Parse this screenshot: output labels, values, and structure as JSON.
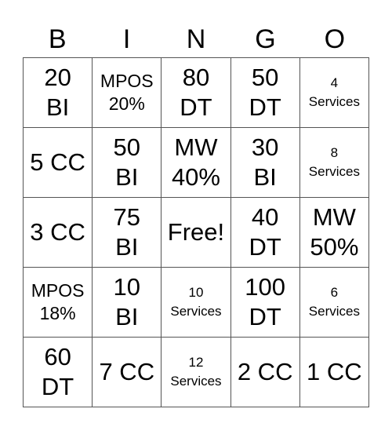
{
  "header": [
    "B",
    "I",
    "N",
    "G",
    "O"
  ],
  "rows": [
    [
      {
        "text": "20\nBI",
        "size": "big"
      },
      {
        "text": "MPOS\n20%",
        "size": "mid"
      },
      {
        "text": "80\nDT",
        "size": "big"
      },
      {
        "text": "50\nDT",
        "size": "big"
      },
      {
        "text": "4\nServices",
        "size": "small"
      }
    ],
    [
      {
        "text": "5 CC",
        "size": "big"
      },
      {
        "text": "50\nBI",
        "size": "big"
      },
      {
        "text": "MW\n40%",
        "size": "big"
      },
      {
        "text": "30\nBI",
        "size": "big"
      },
      {
        "text": "8\nServices",
        "size": "small"
      }
    ],
    [
      {
        "text": "3 CC",
        "size": "big"
      },
      {
        "text": "75\nBI",
        "size": "big"
      },
      {
        "text": "Free!",
        "size": "big"
      },
      {
        "text": "40\nDT",
        "size": "big"
      },
      {
        "text": "MW\n50%",
        "size": "big"
      }
    ],
    [
      {
        "text": "MPOS\n18%",
        "size": "mid"
      },
      {
        "text": "10\nBI",
        "size": "big"
      },
      {
        "text": "10\nServices",
        "size": "small"
      },
      {
        "text": "100\nDT",
        "size": "big"
      },
      {
        "text": "6\nServices",
        "size": "small"
      }
    ],
    [
      {
        "text": "60\nDT",
        "size": "big"
      },
      {
        "text": "7 CC",
        "size": "big"
      },
      {
        "text": "12\nServices",
        "size": "small"
      },
      {
        "text": "2 CC",
        "size": "big"
      },
      {
        "text": "1 CC",
        "size": "big"
      }
    ]
  ]
}
